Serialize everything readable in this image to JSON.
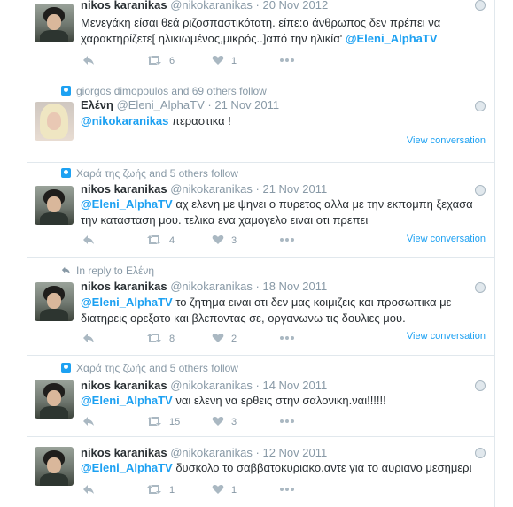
{
  "colors": {
    "link": "#1da1f2",
    "muted": "#8899a6",
    "text": "#292f33",
    "border": "#e1e8ed"
  },
  "tweets": [
    {
      "name": "nikos karanikas",
      "handle": "@nikokaranikas",
      "dot": "·",
      "time": "20 Nov 2012",
      "text_before": "Μενεγάκη είσαι θεά ριζοσπαστικότατη. είπε:ο άνθρωπος δεν πρέπει να χαρακτηρίζετε[ ηλικιωμένος,μικρός..]από την ηλικία' ",
      "mention": "@Eleni_AlphaTV",
      "retweets": "6",
      "likes": "1"
    },
    {
      "context": "giorgos dimopoulos and 69 others follow",
      "name": "Ελένη",
      "handle": "@Eleni_AlphaTV",
      "dot": "·",
      "time": "21 Nov 2011",
      "mention": "@nikokaranikas",
      "text_after": " περαστικα !",
      "view": "View conversation"
    },
    {
      "context": "Χαρά της ζωής and 5 others follow",
      "name": "nikos karanikas",
      "handle": "@nikokaranikas",
      "dot": "·",
      "time": "21 Nov 2011",
      "mention": "@Eleni_AlphaTV",
      "text_after": " αχ ελενη με ψηνει ο πυρετος αλλα με την εκπομπη ξεχασα την κατασταση μου. τελικα ενα χαμογελο ειναι οτι πρεπει",
      "retweets": "4",
      "likes": "3",
      "view": "View conversation"
    },
    {
      "context": "In reply to Ελένη",
      "name": "nikos karanikas",
      "handle": "@nikokaranikas",
      "dot": "·",
      "time": "18 Nov 2011",
      "mention": "@Eleni_AlphaTV",
      "text_after": " το ζητημα ειναι οτι δεν μας κοιμιζεις και προσωπικα με διατηρεις ορεξατο και βλεποντας σε, οργανωνω τις δουλιες μου.",
      "retweets": "8",
      "likes": "2",
      "view": "View conversation"
    },
    {
      "context": "Χαρά της ζωής and 5 others follow",
      "name": "nikos karanikas",
      "handle": "@nikokaranikas",
      "dot": "·",
      "time": "14 Nov 2011",
      "mention": "@Eleni_AlphaTV",
      "text_after": " ναι ελενη να ερθεις στην σαλονικη.ναι!!!!!!",
      "retweets": "15",
      "likes": "3"
    },
    {
      "name": "nikos karanikas",
      "handle": "@nikokaranikas",
      "dot": "·",
      "time": "12 Nov 2011",
      "mention": "@Eleni_AlphaTV",
      "text_after": " δυσκολο το σαββατοκυριακο.αντε για το αυριανο μεσημερι",
      "retweets": "1",
      "likes": "1"
    }
  ]
}
